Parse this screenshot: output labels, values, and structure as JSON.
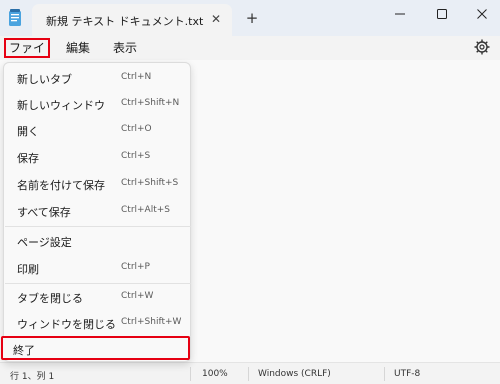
{
  "window": {
    "tab_title": "新規 テキスト ドキュメント.txt",
    "tab_close_icon": "close-icon",
    "new_tab_label": "+",
    "controls": [
      "minimize-icon",
      "maximize-icon",
      "close-icon"
    ]
  },
  "menubar": {
    "items": [
      {
        "label": "ファイル"
      },
      {
        "label": "編集"
      },
      {
        "label": "表示"
      }
    ],
    "settings_icon": "gear-icon"
  },
  "file_menu": {
    "items": [
      {
        "label": "新しいタブ",
        "shortcut": "Ctrl+N"
      },
      {
        "label": "新しいウィンドウ",
        "shortcut": "Ctrl+Shift+N"
      },
      {
        "label": "開く",
        "shortcut": "Ctrl+O"
      },
      {
        "label": "保存",
        "shortcut": "Ctrl+S"
      },
      {
        "label": "名前を付けて保存",
        "shortcut": "Ctrl+Shift+S"
      },
      {
        "label": "すべて保存",
        "shortcut": "Ctrl+Alt+S"
      },
      {
        "label": "ページ設定",
        "shortcut": ""
      },
      {
        "label": "印刷",
        "shortcut": "Ctrl+P"
      },
      {
        "label": "タブを閉じる",
        "shortcut": "Ctrl+W"
      },
      {
        "label": "ウィンドウを閉じる",
        "shortcut": "Ctrl+Shift+W"
      },
      {
        "label": "終了",
        "shortcut": ""
      }
    ]
  },
  "statusbar": {
    "position": "行 1、列 1",
    "zoom": "100%",
    "line_ending": "Windows (CRLF)",
    "encoding": "UTF-8"
  },
  "colors": {
    "highlight": "#e60012",
    "titlebar_bg": "#e9eef5",
    "menu_bg": "#f9f9f9"
  }
}
